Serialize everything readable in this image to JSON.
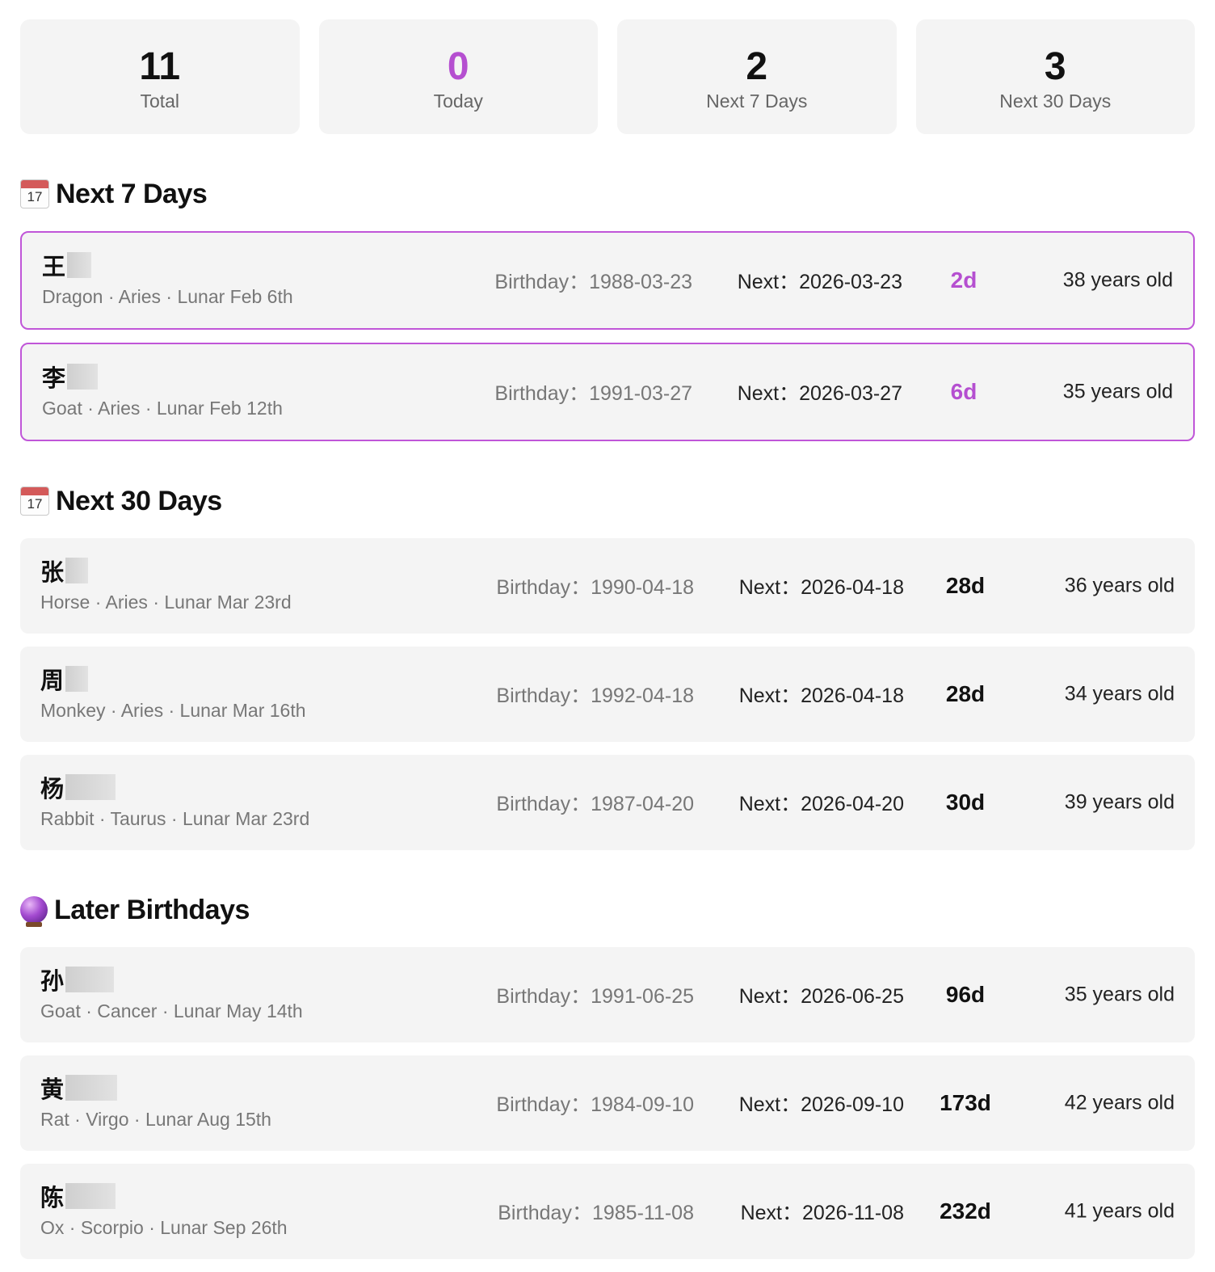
{
  "stats": [
    {
      "value": "11",
      "label": "Total"
    },
    {
      "value": "0",
      "label": "Today"
    },
    {
      "value": "2",
      "label": "Next 7 Days"
    },
    {
      "value": "3",
      "label": "Next 30 Days"
    }
  ],
  "colors": {
    "accent": "#b54fd0",
    "card_bg": "#f4f4f4",
    "muted": "#777777"
  },
  "sections": [
    {
      "title": "Next 7 Days",
      "icon": "calendar-icon",
      "rows": [
        {
          "name": "王",
          "meta": "Dragon · Aries · Lunar Feb 6th",
          "birthday": "Birthday：1988-03-23",
          "next": "Next：2026-03-23",
          "days": "2d",
          "age": "38 years old"
        },
        {
          "name": "李",
          "meta": "Goat · Aries · Lunar Feb 12th",
          "birthday": "Birthday：1991-03-27",
          "next": "Next：2026-03-27",
          "days": "6d",
          "age": "35 years old"
        }
      ]
    },
    {
      "title": "Next 30 Days",
      "icon": "calendar-icon",
      "rows": [
        {
          "name": "张",
          "meta": "Horse · Aries · Lunar Mar 23rd",
          "birthday": "Birthday：1990-04-18",
          "next": "Next：2026-04-18",
          "days": "28d",
          "age": "36 years old"
        },
        {
          "name": "周",
          "meta": "Monkey · Aries · Lunar Mar 16th",
          "birthday": "Birthday：1992-04-18",
          "next": "Next：2026-04-18",
          "days": "28d",
          "age": "34 years old"
        },
        {
          "name": "杨",
          "meta": "Rabbit · Taurus · Lunar Mar 23rd",
          "birthday": "Birthday：1987-04-20",
          "next": "Next：2026-04-20",
          "days": "30d",
          "age": "39 years old"
        }
      ]
    },
    {
      "title": "Later Birthdays",
      "icon": "crystal-ball-icon",
      "rows": [
        {
          "name": "孙",
          "meta": "Goat · Cancer · Lunar May 14th",
          "birthday": "Birthday：1991-06-25",
          "next": "Next：2026-06-25",
          "days": "96d",
          "age": "35 years old"
        },
        {
          "name": "黄",
          "meta": "Rat · Virgo · Lunar Aug 15th",
          "birthday": "Birthday：1984-09-10",
          "next": "Next：2026-09-10",
          "days": "173d",
          "age": "42 years old"
        },
        {
          "name": "陈",
          "meta": "Ox · Scorpio · Lunar Sep 26th",
          "birthday": "Birthday：1985-11-08",
          "next": "Next：2026-11-08",
          "days": "232d",
          "age": "41 years old"
        }
      ]
    }
  ]
}
